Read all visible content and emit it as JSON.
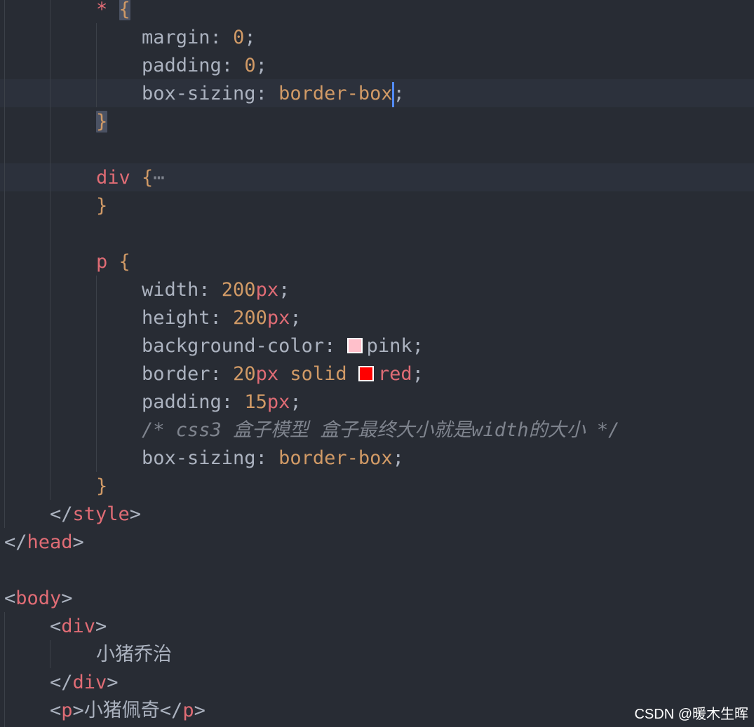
{
  "editor": {
    "line_1": {
      "selector": "*",
      "open_brace": "{"
    },
    "line_2": {
      "prop": "margin",
      "colon": ": ",
      "value": "0",
      "semi": ";"
    },
    "line_3": {
      "prop": "padding",
      "colon": ": ",
      "value": "0",
      "semi": ";"
    },
    "line_4": {
      "prop": "box-sizing",
      "colon": ": ",
      "value": "border-box",
      "semi": ";"
    },
    "line_5": {
      "close_brace": "}"
    },
    "line_7": {
      "selector": "div",
      "open_brace": "{",
      "folded": "⋯"
    },
    "line_8": {
      "close_brace": "}"
    },
    "line_10": {
      "selector": "p",
      "open_brace": "{"
    },
    "line_11": {
      "prop": "width",
      "colon": ": ",
      "num": "200",
      "unit": "px",
      "semi": ";"
    },
    "line_12": {
      "prop": "height",
      "colon": ": ",
      "num": "200",
      "unit": "px",
      "semi": ";"
    },
    "line_13": {
      "prop": "background-color",
      "colon": ": ",
      "value": "pink",
      "semi": ";",
      "swatch_color": "#ffc0cb"
    },
    "line_14": {
      "prop": "border",
      "colon": ": ",
      "num": "20",
      "unit": "px",
      "kw": "solid",
      "value": "red",
      "semi": ";",
      "swatch_color": "#ff0000"
    },
    "line_15": {
      "prop": "padding",
      "colon": ": ",
      "num": "15",
      "unit": "px",
      "semi": ";"
    },
    "line_16": {
      "comment": "/* css3 盒子模型 盒子最终大小就是width的大小 */"
    },
    "line_17": {
      "prop": "box-sizing",
      "colon": ": ",
      "value": "border-box",
      "semi": ";"
    },
    "line_18": {
      "close_brace": "}"
    },
    "line_19": {
      "open": "</",
      "tag": "style",
      "close": ">"
    },
    "line_20": {
      "open": "</",
      "tag": "head",
      "close": ">"
    },
    "line_22": {
      "open": "<",
      "tag": "body",
      "close": ">"
    },
    "line_23": {
      "open": "<",
      "tag": "div",
      "close": ">"
    },
    "line_24": {
      "text": "小猪乔治"
    },
    "line_25": {
      "open": "</",
      "tag": "div",
      "close": ">"
    },
    "line_26": {
      "open": "<",
      "tag": "p",
      "close": ">",
      "text": "小猪佩奇",
      "end_open": "</",
      "end_tag": "p",
      "end_close": ">"
    }
  },
  "watermark": "CSDN @暖木生晖",
  "colors": {
    "background": "#282c34",
    "selector": "#e06c75",
    "value": "#d19a66",
    "comment": "#7f848e",
    "cursor": "#528bff"
  }
}
